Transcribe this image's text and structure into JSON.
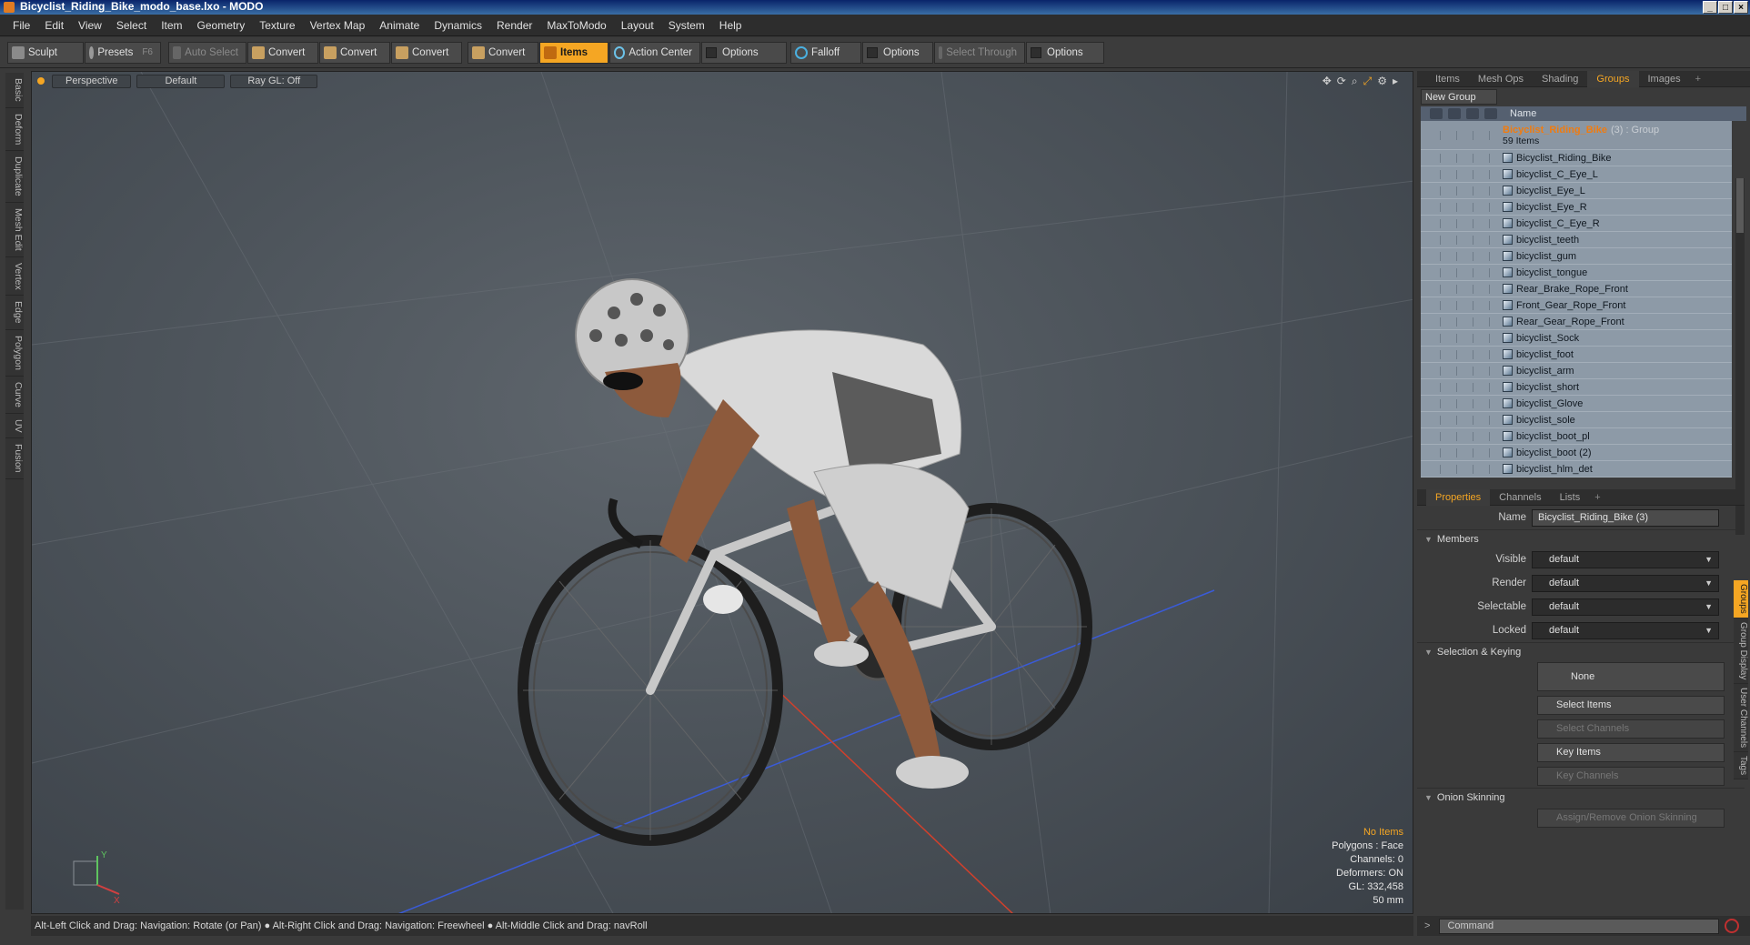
{
  "window": {
    "title": "Bicyclist_Riding_Bike_modo_base.lxo - MODO",
    "controls": [
      "_",
      "□",
      "×"
    ]
  },
  "menu": [
    "File",
    "Edit",
    "View",
    "Select",
    "Item",
    "Geometry",
    "Texture",
    "Vertex Map",
    "Animate",
    "Dynamics",
    "Render",
    "MaxToModo",
    "Layout",
    "System",
    "Help"
  ],
  "toolbar": {
    "sculpt": "Sculpt",
    "presets": "Presets",
    "presets_key": "F6",
    "auto_select": "Auto Select",
    "convert1": "Convert",
    "convert2": "Convert",
    "convert3": "Convert",
    "convert4": "Convert",
    "items": "Items",
    "action_center": "Action Center",
    "options1": "Options",
    "falloff": "Falloff",
    "options2": "Options",
    "select_through": "Select Through",
    "options3": "Options"
  },
  "left_tabs": [
    "Basic",
    "Deform",
    "Duplicate",
    "Mesh Edit",
    "Vertex",
    "Edge",
    "Polygon",
    "Curve",
    "UV",
    "Fusion"
  ],
  "viewport": {
    "view_mode": "Perspective",
    "shading": "Default",
    "raygl": "Ray GL: Off",
    "info": {
      "items": "No Items",
      "polygons": "Polygons : Face",
      "channels": "Channels: 0",
      "deformers": "Deformers: ON",
      "gl": "GL: 332,458",
      "lens": "50 mm"
    },
    "axis_y": "Y",
    "axis_x": "X"
  },
  "status": "Alt-Left Click and Drag: Navigation: Rotate (or Pan) ● Alt-Right Click and Drag: Navigation: Freewheel ● Alt-Middle Click and Drag: navRoll",
  "groups_panel": {
    "tabs": [
      "Items",
      "Mesh Ops",
      "Shading",
      "Groups",
      "Images"
    ],
    "active_tab": "Groups",
    "new_group": "New Group",
    "col_name": "Name",
    "group": {
      "name": "Bicyclist_Riding_Bike",
      "suffix": "(3) : Group",
      "count": "59 Items"
    },
    "items": [
      "Bicyclist_Riding_Bike",
      "bicyclist_C_Eye_L",
      "bicyclist_Eye_L",
      "bicyclist_Eye_R",
      "bicyclist_C_Eye_R",
      "bicyclist_teeth",
      "bicyclist_gum",
      "bicyclist_tongue",
      "Rear_Brake_Rope_Front",
      "Front_Gear_Rope_Front",
      "Rear_Gear_Rope_Front",
      "bicyclist_Sock",
      "bicyclist_foot",
      "bicyclist_arm",
      "bicyclist_short",
      "bicyclist_Glove",
      "bicyclist_sole",
      "bicyclist_boot_pl",
      "bicyclist_boot (2)",
      "bicyclist_hlm_det"
    ]
  },
  "properties": {
    "tabs": [
      "Properties",
      "Channels",
      "Lists"
    ],
    "name_label": "Name",
    "name_value": "Bicyclist_Riding_Bike (3)",
    "members": "Members",
    "fields": [
      {
        "label": "Visible",
        "value": "default"
      },
      {
        "label": "Render",
        "value": "default"
      },
      {
        "label": "Selectable",
        "value": "default"
      },
      {
        "label": "Locked",
        "value": "default"
      }
    ],
    "selection_keying": "Selection & Keying",
    "none": "None",
    "select_items": "Select Items",
    "select_channels": "Select Channels",
    "key_items": "Key Items",
    "key_channels": "Key Channels",
    "onion": "Onion Skinning",
    "assign_onion": "Assign/Remove Onion Skinning",
    "side_tabs": [
      "Groups",
      "Group Display",
      "User Channels",
      "Tags"
    ]
  },
  "command": {
    "prompt": ">",
    "placeholder": "Command"
  },
  "colors": {
    "accent": "#f5a623",
    "group_name": "#f07c10"
  }
}
